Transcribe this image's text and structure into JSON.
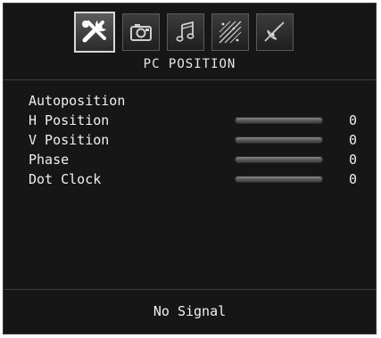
{
  "menu": {
    "tabs": [
      {
        "icon": "tools-icon",
        "active": true
      },
      {
        "icon": "camera-icon",
        "active": false
      },
      {
        "icon": "music-note-icon",
        "active": false
      },
      {
        "icon": "sparkle-wand-icon",
        "active": false
      },
      {
        "icon": "satellite-icon",
        "active": false
      }
    ],
    "title": "PC POSITION"
  },
  "settings": {
    "items": [
      {
        "label": "Autoposition",
        "has_bar": false
      },
      {
        "label": "H Position",
        "value": "0",
        "level": 0,
        "has_bar": true
      },
      {
        "label": "V Position",
        "value": "0",
        "level": 0,
        "has_bar": true
      },
      {
        "label": "Phase",
        "value": "0",
        "level": 0,
        "has_bar": true
      },
      {
        "label": "Dot Clock",
        "value": "0",
        "level": 0,
        "has_bar": true
      }
    ]
  },
  "status": {
    "text": "No Signal"
  },
  "colors": {
    "background": "#161616",
    "text": "#ececec",
    "bar": "#6a6a6a"
  }
}
